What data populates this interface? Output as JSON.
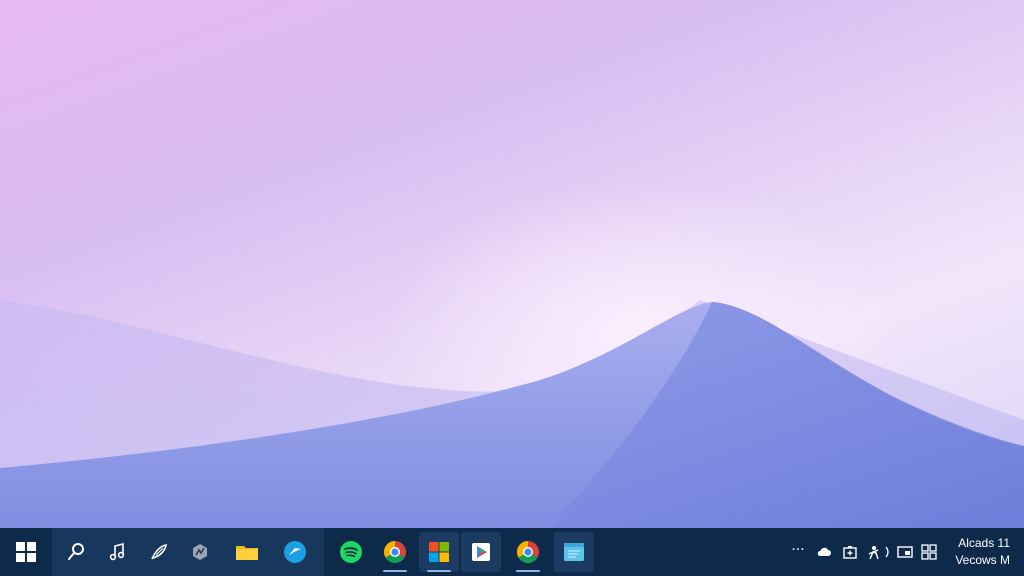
{
  "desktop": {
    "wallpaper": "purple-dune-wallpaper",
    "colors": {
      "sky_top": "#e9b9f3",
      "sky_light": "#f1e6fb",
      "dune": "#8e98e6",
      "dune_shadow": "#6f7fdc"
    }
  },
  "taskbar": {
    "background": "#0e2a4a",
    "start": {
      "icon": "windows-logo-icon"
    },
    "pinned": [
      {
        "id": "search",
        "icon": "search-icon"
      },
      {
        "id": "music",
        "icon": "music-note-icon"
      },
      {
        "id": "feather",
        "icon": "feather-icon"
      },
      {
        "id": "app-gray",
        "icon": "app-gray-icon"
      },
      {
        "id": "file-explorer",
        "icon": "folder-icon"
      },
      {
        "id": "edge",
        "icon": "edge-browser-icon"
      }
    ],
    "apps": [
      {
        "id": "spotify",
        "icon": "spotify-icon",
        "running": false
      },
      {
        "id": "chrome-1",
        "icon": "chrome-icon",
        "running": true
      },
      {
        "id": "microsoft-store",
        "icon": "microsoft-store-icon",
        "running": true,
        "active": true
      },
      {
        "id": "play-store",
        "icon": "play-store-icon",
        "running": false,
        "active": true
      },
      {
        "id": "chrome-2",
        "icon": "chrome-icon",
        "running": true
      },
      {
        "id": "notepad",
        "icon": "notepad-icon",
        "running": false,
        "active": true
      }
    ],
    "tray": {
      "overflow_label": "···",
      "icons": [
        "cloud-icon",
        "battery-icon",
        "person-icon",
        "bluetooth-icon",
        "display-icon",
        "grid-icon"
      ]
    },
    "clock": {
      "line1": "Alcads 11",
      "line2": "Vecows M"
    }
  }
}
